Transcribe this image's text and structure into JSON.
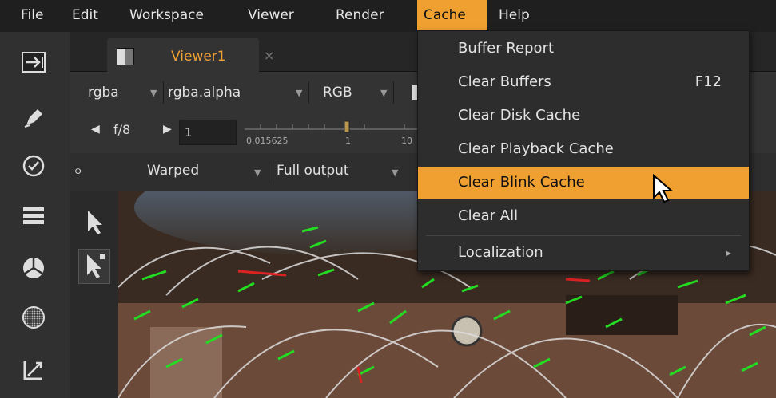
{
  "menubar": {
    "items": [
      "File",
      "Edit",
      "Workspace",
      "Viewer",
      "Render",
      "Cache",
      "Help"
    ]
  },
  "viewer": {
    "tab_label": "Viewer1",
    "tab_close": "×",
    "channels": "rgba",
    "alpha_channel": "rgba.alpha",
    "colorspace": "RGB",
    "fstop": "f/8",
    "frame": "1",
    "slider_ticks": [
      "0.015625",
      "1",
      "10"
    ],
    "mode": "Warped",
    "output": "Full output"
  },
  "cache_menu": {
    "items": [
      {
        "label": "Buffer Report",
        "shortcut": ""
      },
      {
        "label": "Clear Buffers",
        "shortcut": "F12"
      },
      {
        "label": "Clear Disk Cache",
        "shortcut": ""
      },
      {
        "label": "Clear Playback Cache",
        "shortcut": ""
      },
      {
        "label": "Clear Blink Cache",
        "shortcut": ""
      },
      {
        "label": "Clear All",
        "shortcut": ""
      },
      {
        "label": "Localization",
        "shortcut": ""
      }
    ],
    "highlighted": "Clear Blink Cache",
    "submenu_arrow": "▸"
  },
  "colors": {
    "accent": "#f0a030",
    "menubar_bg": "#1f1f1f",
    "panel_bg": "#333333",
    "track_green": "#22dd22",
    "track_red": "#dd2222"
  },
  "icons": {
    "left_toolbar": [
      "import-icon",
      "pen-icon",
      "clock-icon",
      "layers-icon",
      "transform-icon",
      "sphere-icon",
      "measure-icon"
    ],
    "side_tools": [
      "select-arrow-icon",
      "transform-arrow-icon"
    ]
  }
}
